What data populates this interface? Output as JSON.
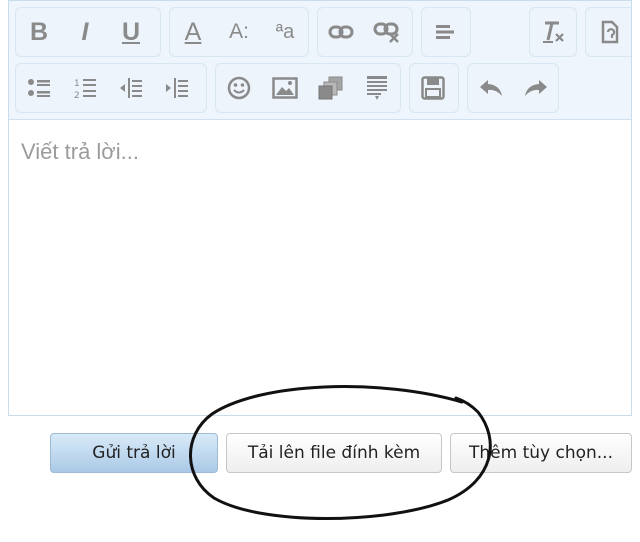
{
  "editor": {
    "placeholder": "Viết trả lời...",
    "toolbar": {
      "row1": [
        {
          "icon": "bold-icon",
          "glyph": "B"
        },
        {
          "icon": "italic-icon",
          "glyph": "I"
        },
        {
          "icon": "underline-icon",
          "glyph": "U"
        },
        {
          "icon": "font-color-icon",
          "glyph": "A"
        },
        {
          "icon": "font-size-icon",
          "glyph": "A:"
        },
        {
          "icon": "font-family-icon",
          "glyph": "ªa"
        },
        {
          "icon": "link-icon"
        },
        {
          "icon": "unlink-icon"
        },
        {
          "icon": "align-icon"
        },
        {
          "icon": "remove-format-icon"
        },
        {
          "icon": "toggle-bbcode-icon"
        }
      ],
      "row2": [
        {
          "icon": "bullet-list-icon"
        },
        {
          "icon": "numbered-list-icon"
        },
        {
          "icon": "outdent-icon"
        },
        {
          "icon": "indent-icon"
        },
        {
          "icon": "smilie-icon"
        },
        {
          "icon": "image-icon"
        },
        {
          "icon": "media-icon"
        },
        {
          "icon": "insert-icon"
        },
        {
          "icon": "save-draft-icon"
        },
        {
          "icon": "undo-icon"
        },
        {
          "icon": "redo-icon"
        }
      ]
    }
  },
  "buttons": {
    "reply": "Gửi trả lời",
    "upload": "Tải lên file đính kèm",
    "more": "Thêm tùy chọn..."
  },
  "colors": {
    "toolbar_bg": "#eef5fc",
    "border": "#c9dcec",
    "icon": "#8a8a8a",
    "primary_button": "#aac9e6",
    "annotation": "#111111"
  }
}
